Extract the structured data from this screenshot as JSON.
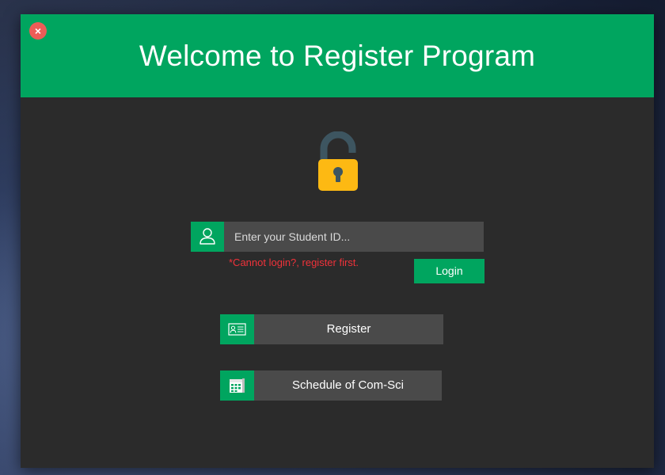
{
  "window": {
    "title": "Welcome to Register Program",
    "close_glyph": "×"
  },
  "login": {
    "placeholder": "Enter your Student ID...",
    "value": "",
    "error_text": "*Cannot login?, register first.",
    "login_label": "Login"
  },
  "actions": {
    "register_label": "Register",
    "schedule_label": "Schedule of Com-Sci"
  },
  "icons": {
    "close": "close-icon",
    "lock": "padlock-icon",
    "user": "user-icon",
    "id_card": "id-card-icon",
    "calendar": "calendar-icon"
  },
  "colors": {
    "accent": "#00a55f",
    "window_bg": "#2b2b2b",
    "field_bg": "#4a4a4a",
    "error": "#f0323a",
    "lock_body": "#fdb913",
    "lock_shackle": "#3d5560",
    "close": "#ec5c57"
  }
}
